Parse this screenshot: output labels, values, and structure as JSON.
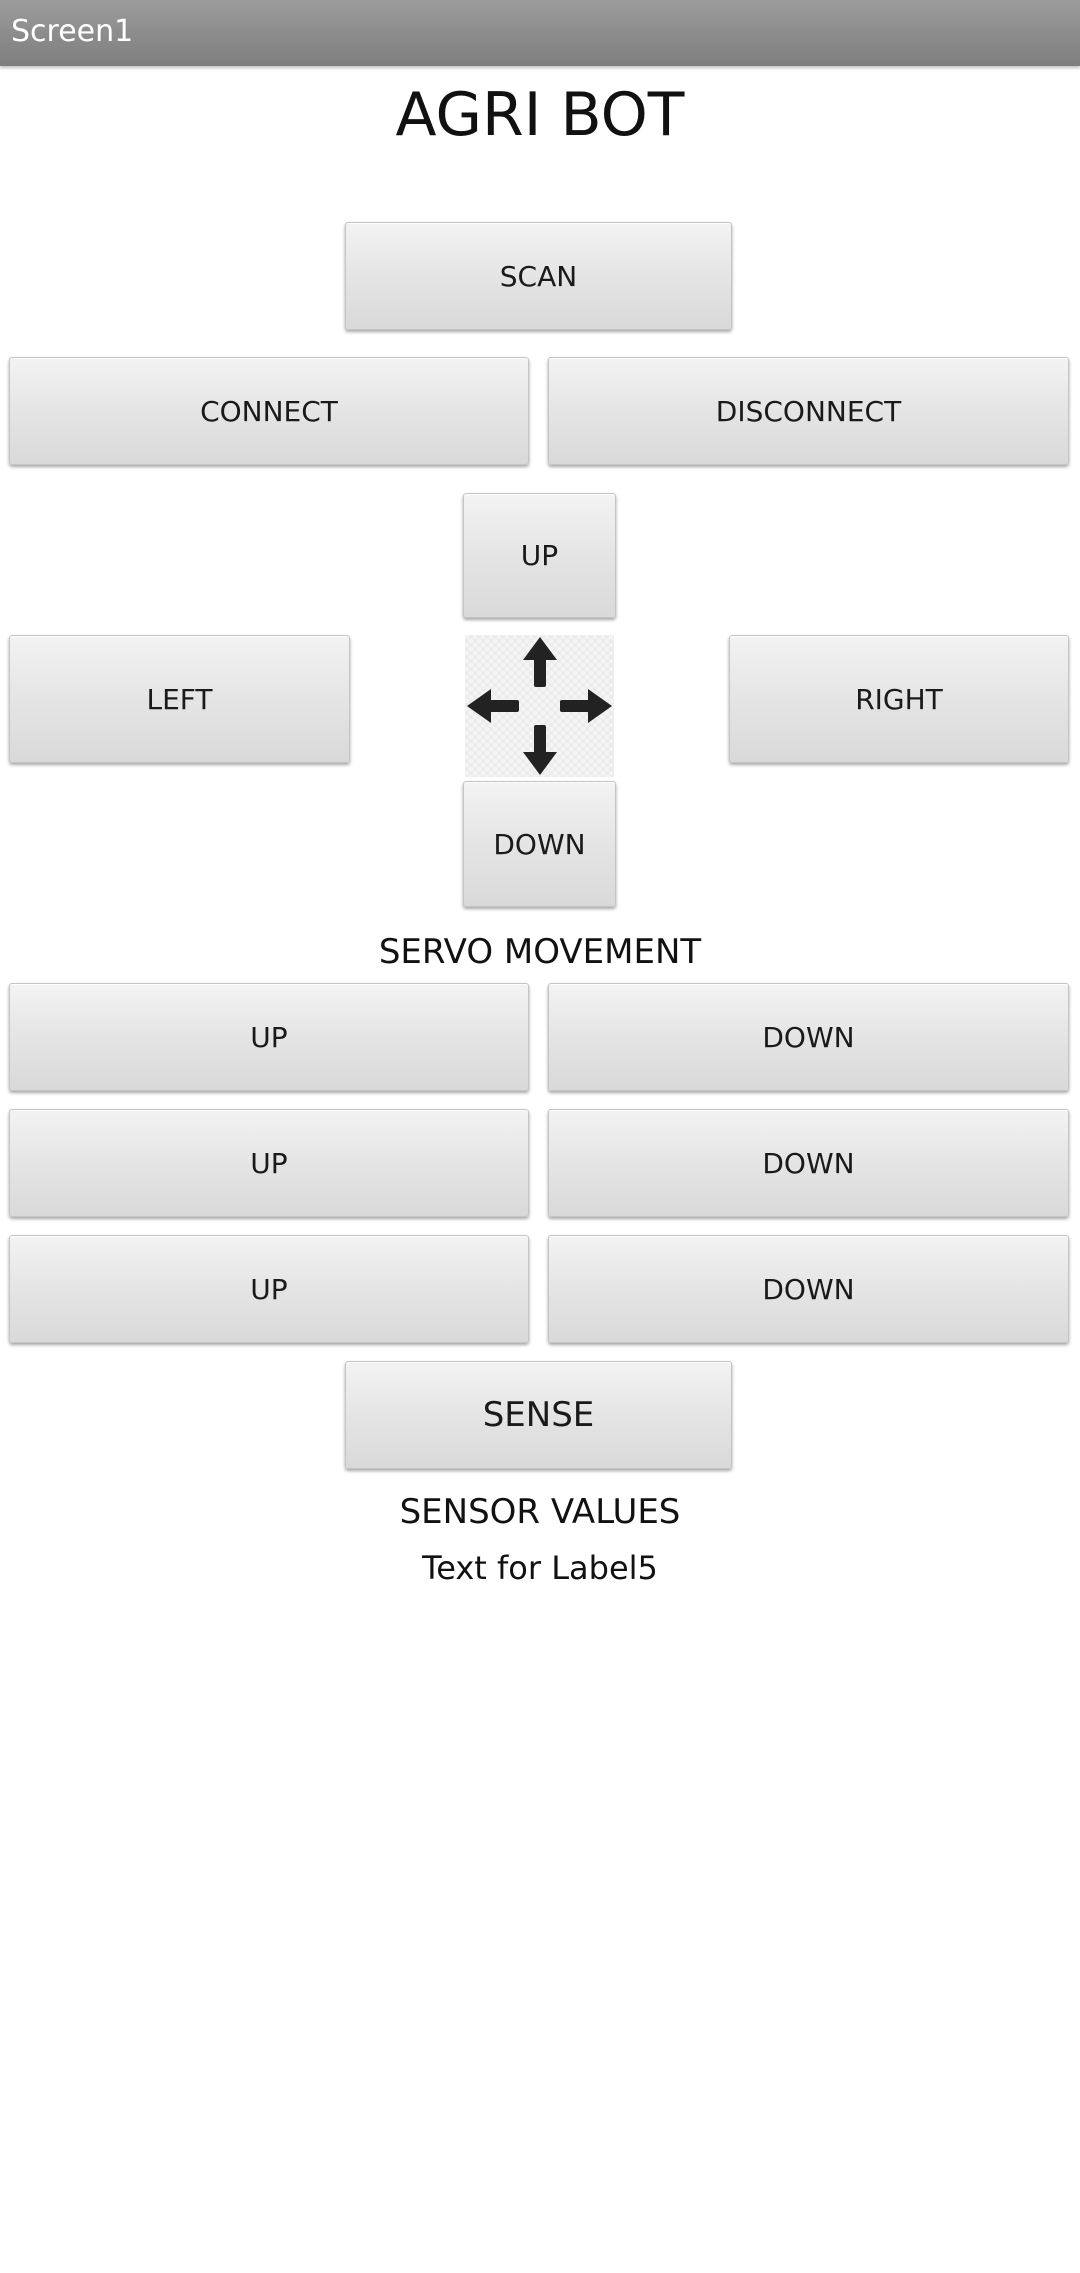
{
  "window": {
    "title": "Screen1"
  },
  "app": {
    "title": "AGRI BOT"
  },
  "buttons": {
    "scan": "SCAN",
    "connect": "CONNECT",
    "disconnect": "DISCONNECT",
    "up": "UP",
    "left": "LEFT",
    "right": "RIGHT",
    "down": "DOWN",
    "sense": "SENSE"
  },
  "dpad": {
    "icon": "four-direction-arrows-icon"
  },
  "servo": {
    "title": "SERVO MOVEMENT",
    "rows": [
      {
        "up": "UP",
        "down": "DOWN"
      },
      {
        "up": "UP",
        "down": "DOWN"
      },
      {
        "up": "UP",
        "down": "DOWN"
      }
    ]
  },
  "sensor": {
    "title": "SENSOR VALUES",
    "value": "Text for Label5"
  },
  "colors": {
    "titlebar": "#8a8a8a",
    "button_face": "#e6e6e6",
    "text": "#111111"
  }
}
